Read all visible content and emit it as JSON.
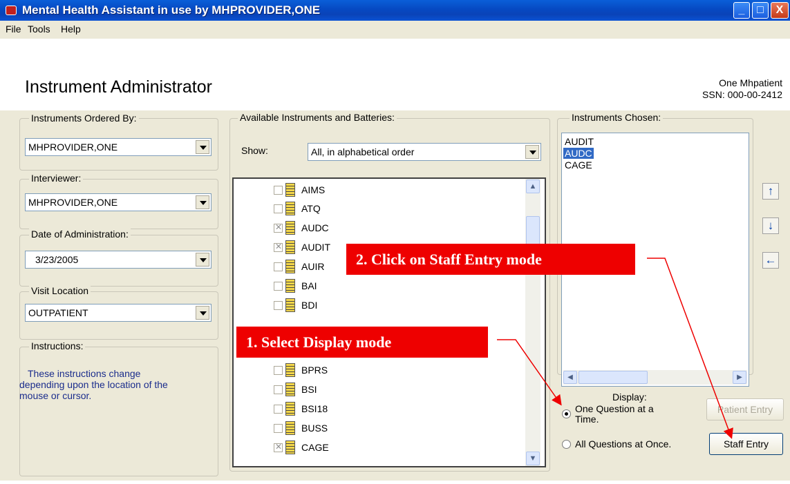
{
  "window": {
    "title": "Mental Health Assistant in use by MHPROVIDER,ONE",
    "min_symbol": "_",
    "max_symbol": "□",
    "close_symbol": "X"
  },
  "menu": [
    "File",
    "Tools",
    "Help"
  ],
  "heading": "Instrument Administrator",
  "patient": {
    "name": "One Mhpatient",
    "ssn": "SSN: 000-00-2412"
  },
  "ordered_by": {
    "label": "Instruments Ordered By:",
    "value": "MHPROVIDER,ONE"
  },
  "interviewer": {
    "label": "Interviewer:",
    "value": "MHPROVIDER,ONE"
  },
  "date": {
    "label": "Date of Administration:",
    "value": "3/23/2005"
  },
  "location": {
    "label": "Visit Location",
    "value": "OUTPATIENT"
  },
  "instructions": {
    "label": "Instructions:",
    "text_line1": "These instructions change",
    "text_line2": "depending upon the location of the",
    "text_line3": "mouse or cursor."
  },
  "available": {
    "label": "Available Instruments and Batteries:",
    "show_label": "Show:",
    "show_value": "All, in alphabetical order",
    "items": [
      {
        "name": "AIMS",
        "checked": false
      },
      {
        "name": "ATQ",
        "checked": false
      },
      {
        "name": "AUDC",
        "checked": true
      },
      {
        "name": "AUDIT",
        "checked": true
      },
      {
        "name": "AUIR",
        "checked": false
      },
      {
        "name": "BAI",
        "checked": false
      },
      {
        "name": "BDI",
        "checked": false
      },
      {
        "name": "BPRS",
        "checked": false
      },
      {
        "name": "BSI",
        "checked": false
      },
      {
        "name": "BSI18",
        "checked": false
      },
      {
        "name": "BUSS",
        "checked": false
      },
      {
        "name": "CAGE",
        "checked": true
      }
    ]
  },
  "chosen": {
    "label": "Instruments Chosen:",
    "items": [
      "AUDIT",
      "AUDC",
      "CAGE"
    ],
    "selected": "AUDC"
  },
  "display": {
    "label": "Display:",
    "option1_line1": "One Question at a",
    "option1_line2": "Time.",
    "option2": "All Questions at Once.",
    "selected": "One Question at a Time."
  },
  "buttons": {
    "patient_entry": "Patient Entry",
    "staff_entry": "Staff Entry"
  },
  "callouts": {
    "step1": "1. Select Display mode",
    "step2": "2. Click on Staff Entry mode"
  },
  "colors": {
    "titlebar": "#0a52d0",
    "callout": "#ee0000",
    "selection": "#316ac5"
  }
}
